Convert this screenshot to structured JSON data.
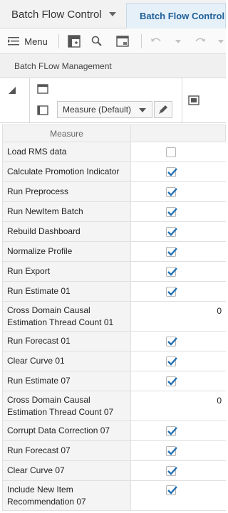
{
  "tabs": {
    "dropdown_label": "Batch Flow Control",
    "active_label": "Batch Flow Control"
  },
  "toolbar": {
    "menu_label": "Menu"
  },
  "section": {
    "title": "Batch FLow Management"
  },
  "pivot": {
    "measure_dropdown": "Measure (Default)"
  },
  "grid": {
    "column_header": "Measure",
    "rows": [
      {
        "label": "Load RMS data",
        "checked": false
      },
      {
        "label": "Calculate Promotion Indicator",
        "checked": true
      },
      {
        "label": "Run Preprocess",
        "checked": true
      },
      {
        "label": "Run NewItem Batch",
        "checked": true
      },
      {
        "label": "Rebuild Dashboard",
        "checked": true
      },
      {
        "label": "Normalize Profile",
        "checked": true
      },
      {
        "label": "Run Export",
        "checked": true
      },
      {
        "label": "Run Estimate 01",
        "checked": true
      },
      {
        "label": "Cross Domain Causal Estimation Thread Count 01",
        "value": "0"
      },
      {
        "label": "Run Forecast 01",
        "checked": true
      },
      {
        "label": "Clear Curve 01",
        "checked": true
      },
      {
        "label": "Run Estimate 07",
        "checked": true
      },
      {
        "label": "Cross Domain Causal Estimation Thread Count 07",
        "value": "0"
      },
      {
        "label": "Corrupt Data Correction 07",
        "checked": true
      },
      {
        "label": "Run Forecast 07",
        "checked": true
      },
      {
        "label": "Clear Curve 07",
        "checked": true
      },
      {
        "label": "Include New Item Recommendation 07",
        "checked": true
      }
    ]
  },
  "colors": {
    "accent": "#1f6fb2",
    "check": "#1f6fb2"
  }
}
